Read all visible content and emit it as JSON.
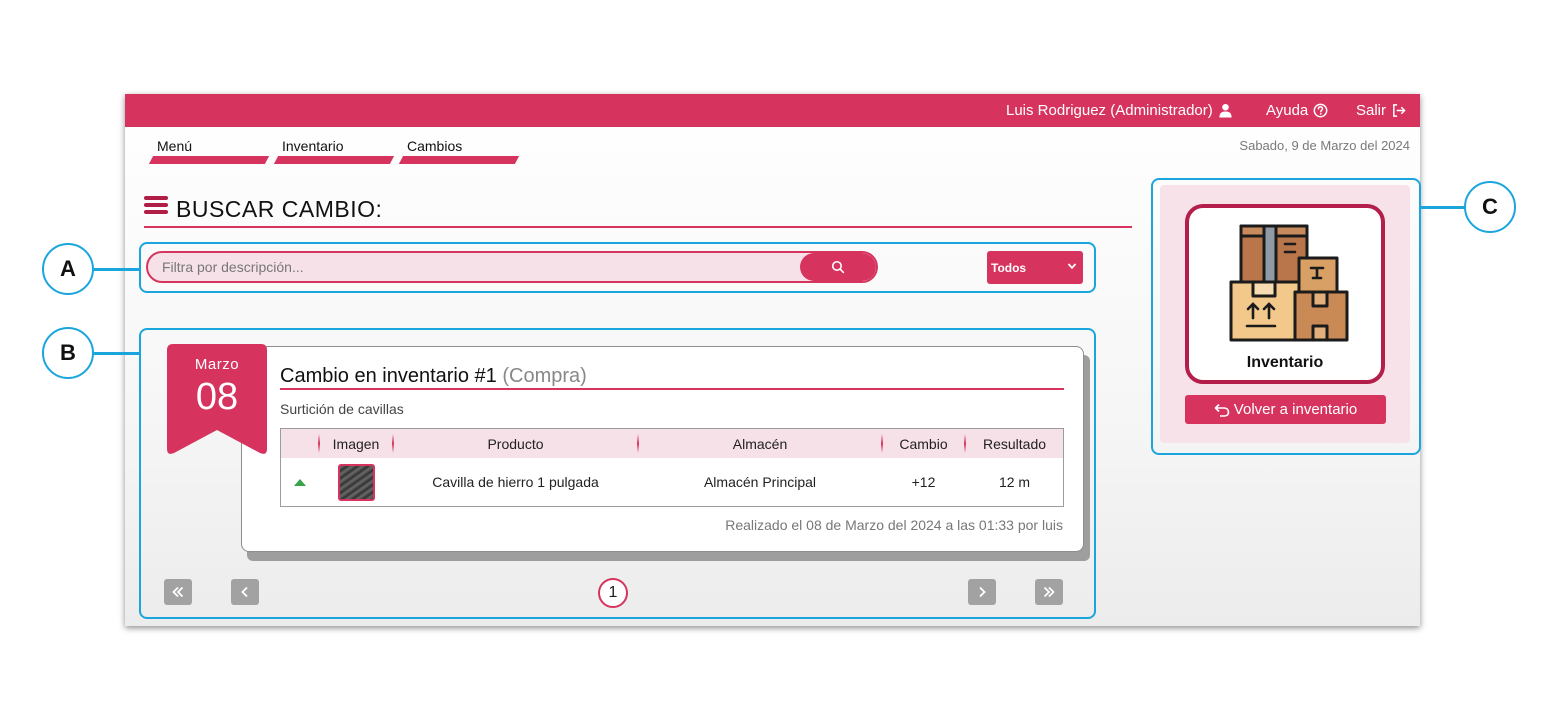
{
  "topbar": {
    "user_label": "Luis Rodriguez (Administrador)",
    "help_label": "Ayuda",
    "logout_label": "Salir"
  },
  "nav": {
    "items": [
      {
        "label": "Menú"
      },
      {
        "label": "Inventario"
      },
      {
        "label": "Cambios"
      }
    ]
  },
  "date_text": "Sabado, 9 de Marzo del 2024",
  "page_title": "BUSCAR CAMBIO:",
  "search": {
    "placeholder": "Filtra por descripción...",
    "value": ""
  },
  "filter": {
    "selected": "Todos"
  },
  "change_card": {
    "month": "Marzo",
    "day": "08",
    "title": "Cambio en inventario #1",
    "type": "(Compra)",
    "description": "Surtición de cavillas",
    "columns": [
      "Imagen",
      "Producto",
      "Almacén",
      "Cambio",
      "Resultado"
    ],
    "rows": [
      {
        "product": "Cavilla de hierro 1 pulgada",
        "warehouse": "Almacén Principal",
        "change": "+12",
        "result": "12 m"
      }
    ],
    "footer": "Realizado el 08 de Marzo del 2024 a las 01:33 por luis"
  },
  "pagination": {
    "current_page": "1"
  },
  "side_panel": {
    "tile_label": "Inventario",
    "back_label": "Volver a inventario"
  },
  "callouts": {
    "a": "A",
    "b": "B",
    "c": "C"
  },
  "colors": {
    "brand": "#d6345f",
    "brand_dark": "#b31e4a",
    "soft_pink": "#f7e1e8",
    "callout": "#1aa6dd",
    "increase": "#3aa24b"
  },
  "icons": {
    "user": "user-icon",
    "help": "help-icon",
    "logout": "logout-icon",
    "menu": "hamburger-icon",
    "search": "search-icon",
    "dropdown": "chevron-down-icon",
    "increase": "arrow-up-icon",
    "first": "double-chevron-left-icon",
    "prev": "chevron-left-icon",
    "next": "chevron-right-icon",
    "last": "double-chevron-right-icon",
    "boxes": "boxes-icon",
    "back": "undo-arrow-icon"
  }
}
